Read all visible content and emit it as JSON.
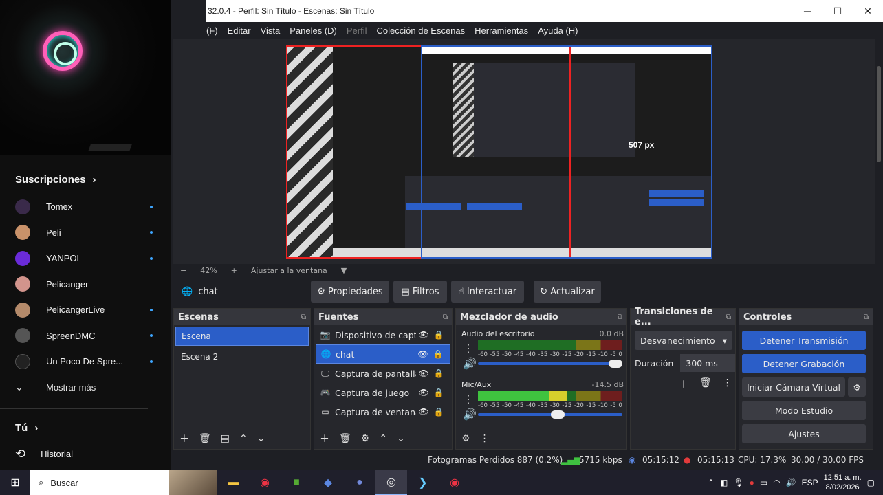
{
  "youtube": {
    "subscriptions_title": "Suscripciones",
    "channels": [
      {
        "name": "Tomex",
        "avatar_color": "#3a2a4a"
      },
      {
        "name": "Peli",
        "avatar_color": "#c9926a"
      },
      {
        "name": "YANPOL",
        "avatar_color": "#6a2bd9"
      },
      {
        "name": "Pelicanger",
        "avatar_color": "#d2948c"
      },
      {
        "name": "PelicangerLive",
        "avatar_color": "#b48a6a"
      },
      {
        "name": "SpreenDMC",
        "avatar_color": "#555555"
      },
      {
        "name": "Un Poco De Spre...",
        "avatar_color": "#222222"
      }
    ],
    "show_more": "Mostrar más",
    "you_label": "Tú",
    "history_label": "Historial"
  },
  "obs": {
    "title": "32.0.4 - Perfil: Sin Título - Escenas: Sin Título",
    "menu": [
      "(F)",
      "Editar",
      "Vista",
      "Paneles (D)",
      "Perfil",
      "Colección de Escenas",
      "Herramientas",
      "Ayuda (H)"
    ],
    "preview": {
      "px_label": "507 px",
      "zoom": "42%",
      "fit_label": "Ajustar a la ventana"
    },
    "context": {
      "source": "chat",
      "properties": "Propiedades",
      "filters": "Filtros",
      "interact": "Interactuar",
      "refresh": "Actualizar"
    },
    "scenes": {
      "title": "Escenas",
      "items": [
        "Escena",
        "Escena 2"
      ],
      "selected": 0
    },
    "sources": {
      "title": "Fuentes",
      "items": [
        {
          "name": "Dispositivo de captu",
          "icon": "camera-icon"
        },
        {
          "name": "chat",
          "icon": "browser-icon"
        },
        {
          "name": "Captura de pantalla",
          "icon": "monitor-icon"
        },
        {
          "name": "Captura de juego",
          "icon": "gamepad-icon"
        },
        {
          "name": "Captura de ventana",
          "icon": "window-icon"
        }
      ],
      "selected": 1
    },
    "mixer": {
      "title": "Mezclador de audio",
      "channels": [
        {
          "name": "Audio del escritorio",
          "db": "0.0 dB",
          "level": 0.0,
          "fader": 1.0
        },
        {
          "name": "Mic/Aux",
          "db": "-14.5 dB",
          "level": 0.62,
          "fader": 0.55
        }
      ],
      "scale": [
        "-60",
        "-55",
        "-50",
        "-45",
        "-40",
        "-35",
        "-30",
        "-25",
        "-20",
        "-15",
        "-10",
        "-5",
        "0"
      ]
    },
    "transitions": {
      "title": "Transiciones de e...",
      "selected": "Desvanecimiento",
      "duration_label": "Duración",
      "duration_value": "300 ms"
    },
    "controls": {
      "title": "Controles",
      "stop_stream": "Detener Transmisión",
      "stop_record": "Detener Grabación",
      "virtual_cam": "Iniciar Cámara Virtual",
      "studio_mode": "Modo Estudio",
      "settings": "Ajustes"
    },
    "status": {
      "dropped": "Fotogramas Perdidos 887 (0.2%)",
      "bitrate": "5715 kbps",
      "stream_time": "05:15:12",
      "rec_time": "05:15:13",
      "cpu": "CPU: 17.3%",
      "fps": "30.00 / 30.00 FPS"
    }
  },
  "taskbar": {
    "search_placeholder": "Buscar",
    "lang": "ESP",
    "time": "12:51 a. m.",
    "date": "8/02/2026"
  },
  "colors": {
    "accent": "#2b5ec8",
    "record_red": "#e23b3b",
    "bitrate_green": "#3fc23f"
  }
}
